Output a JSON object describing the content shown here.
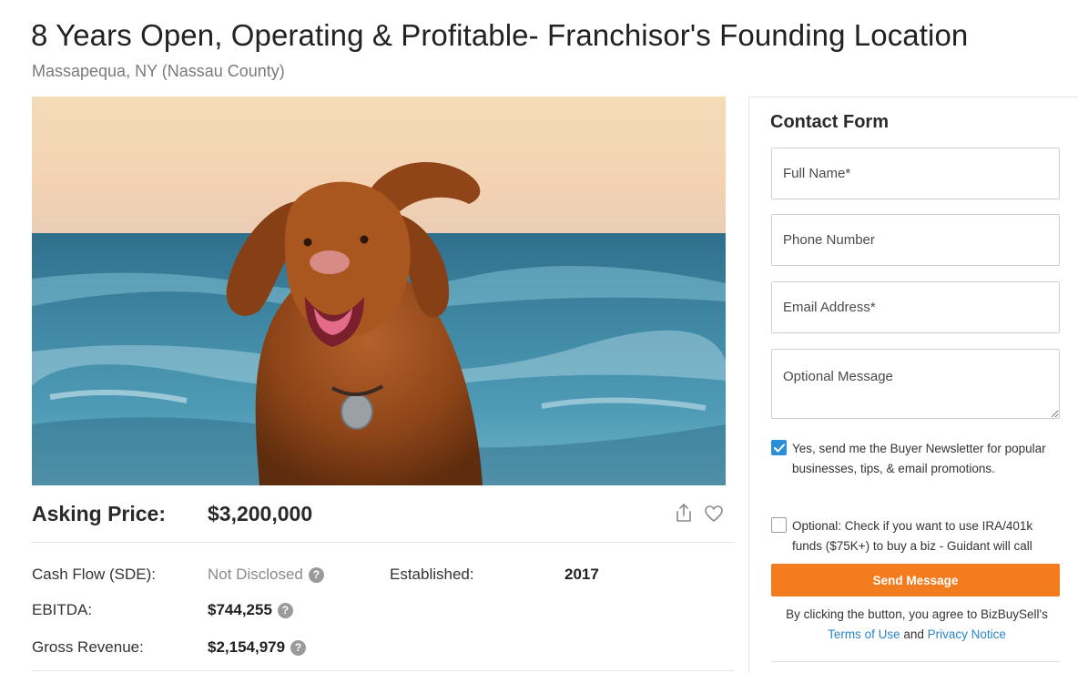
{
  "listing": {
    "title": "8 Years Open, Operating & Profitable- Franchisor's Founding Location",
    "location": "Massapequa, NY (Nassau County)",
    "hero_icon": "dog-photo"
  },
  "price": {
    "asking_label": "Asking Price:",
    "asking_value": "$3,200,000"
  },
  "financials": {
    "cash_flow_label": "Cash Flow (SDE):",
    "cash_flow_value": "Not Disclosed",
    "established_label": "Established:",
    "established_value": "2017",
    "ebitda_label": "EBITDA:",
    "ebitda_value": "$744,255",
    "gross_revenue_label": "Gross Revenue:",
    "gross_revenue_value": "$2,154,979",
    "help_glyph": "?"
  },
  "contact_form": {
    "title": "Contact Form",
    "full_name_placeholder": "Full Name*",
    "phone_placeholder": "Phone Number",
    "email_placeholder": "Email Address*",
    "message_placeholder": "Optional Message",
    "newsletter_text": "Yes, send me the Buyer Newsletter for popular businesses, tips, & email promotions.",
    "newsletter_checked": true,
    "ira_text": "Optional: Check if you want to use IRA/401k funds ($75K+) to buy a biz - Guidant will call",
    "ira_checked": false,
    "send_label": "Send Message",
    "disclaimer_prefix": "By clicking the button, you agree to BizBuySell's",
    "terms_link": "Terms of Use",
    "disclaimer_and": "and",
    "privacy_link": "Privacy Notice"
  },
  "colors": {
    "accent_orange": "#f27c1e",
    "link_blue": "#2a86c9",
    "checkbox_blue": "#2a8fd6"
  }
}
